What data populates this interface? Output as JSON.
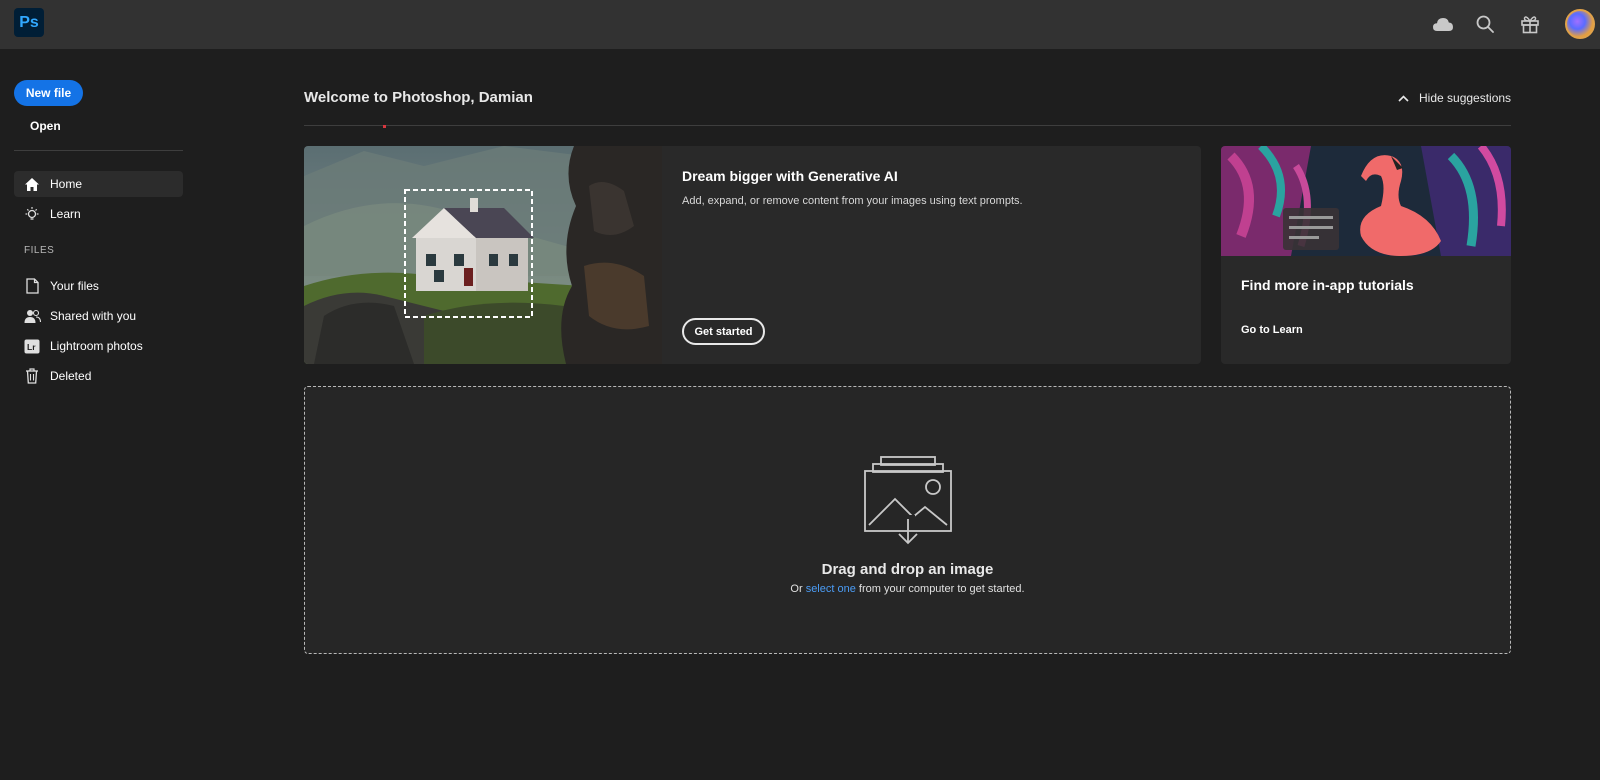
{
  "app": {
    "logo_text": "Ps"
  },
  "topbar": {
    "icons": [
      "cloud-icon",
      "search-icon",
      "gift-icon",
      "avatar"
    ]
  },
  "sidebar": {
    "new_file_label": "New file",
    "open_label": "Open",
    "nav": [
      {
        "label": "Home",
        "icon": "home-icon",
        "active": true
      },
      {
        "label": "Learn",
        "icon": "lightbulb-icon",
        "active": false
      }
    ],
    "files_header": "FILES",
    "files": [
      {
        "label": "Your files",
        "icon": "file-icon"
      },
      {
        "label": "Shared with you",
        "icon": "users-icon"
      },
      {
        "label": "Lightroom photos",
        "icon": "lightroom-icon"
      },
      {
        "label": "Deleted",
        "icon": "trash-icon"
      }
    ]
  },
  "main": {
    "welcome": "Welcome to Photoshop, Damian",
    "hide_suggestions": "Hide suggestions",
    "gen_card": {
      "title": "Dream bigger with Generative AI",
      "description": "Add, expand, or remove content from your images using text prompts.",
      "button": "Get started"
    },
    "tutorial_card": {
      "title": "Find more in-app tutorials",
      "link": "Go to Learn"
    },
    "drop_zone": {
      "title": "Drag and drop an image",
      "sub_before": "Or ",
      "sub_link": "select one",
      "sub_after": " from your computer to get started."
    }
  },
  "colors": {
    "accent": "#1473e6",
    "link": "#4b9cf5",
    "topbar": "#323232",
    "background": "#1e1e1e",
    "card": "#292929"
  }
}
